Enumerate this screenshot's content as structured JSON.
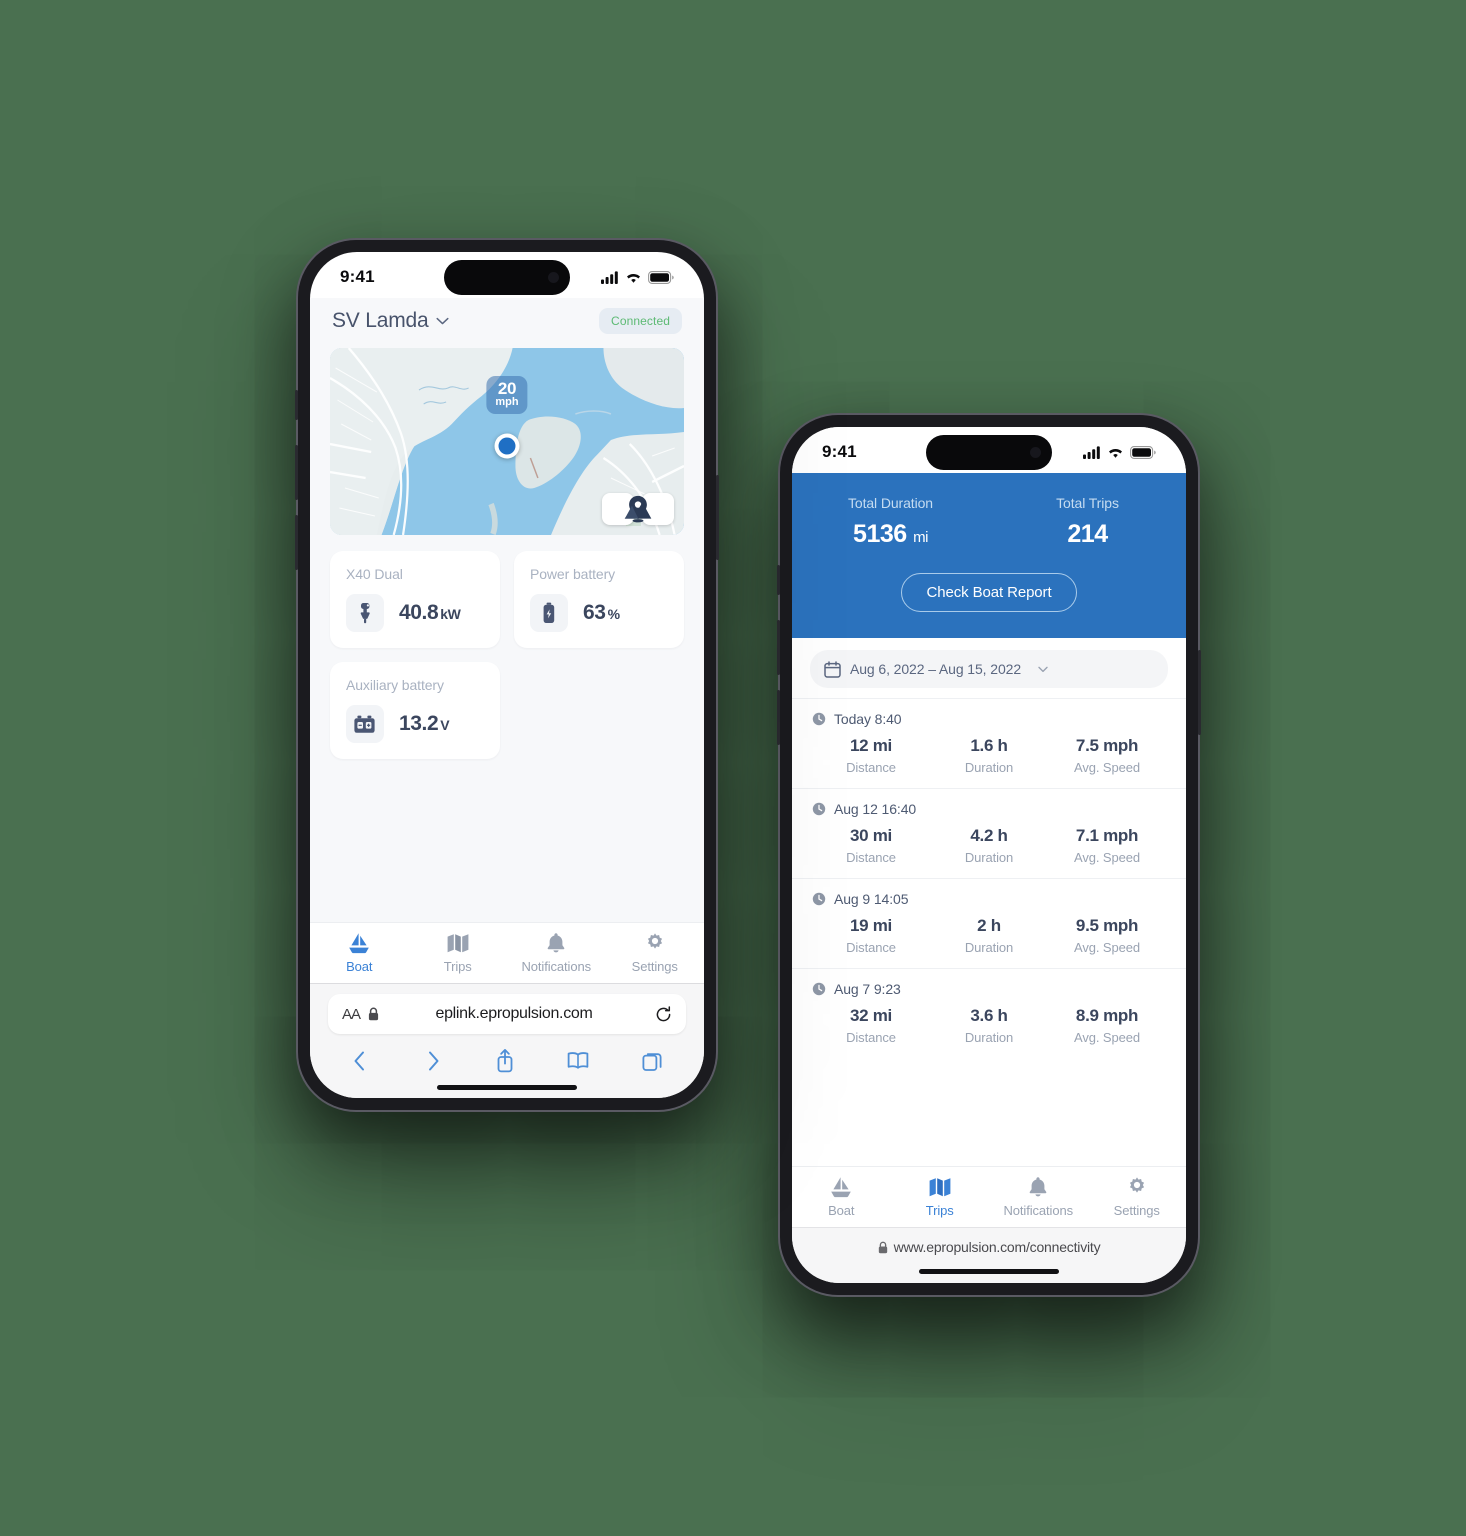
{
  "background_color": "#4a7050",
  "accent_blue": "#2b72bd",
  "phone_left": {
    "status_bar": {
      "time": "9:41",
      "signal_icon": "cellular-bars-icon",
      "wifi_icon": "wifi-icon",
      "battery_icon": "battery-icon"
    },
    "header": {
      "boat_name": "SV Lamda",
      "chevron_icon": "chevron-down-icon",
      "status_badge": "Connected",
      "status_color": "#5dba74"
    },
    "map": {
      "speed_value": "20",
      "speed_unit": "mph",
      "locate_icon": "location-pin-icon",
      "layers_icon": "mountain-layers-icon",
      "position_marker": "current-position-dot"
    },
    "cards": [
      {
        "label": "X40 Dual",
        "value": "40.8",
        "unit": "kW",
        "icon": "outboard-motor-icon"
      },
      {
        "label": "Power battery",
        "value": "63",
        "unit": "%",
        "icon": "battery-vertical-icon"
      },
      {
        "label": "Auxiliary battery",
        "value": "13.2",
        "unit": "V",
        "icon": "car-battery-icon"
      }
    ],
    "tabs": [
      {
        "label": "Boat",
        "icon": "sailboat-icon",
        "active": true
      },
      {
        "label": "Trips",
        "icon": "map-folded-icon",
        "active": false
      },
      {
        "label": "Notifications",
        "icon": "bell-icon",
        "active": false
      },
      {
        "label": "Settings",
        "icon": "gear-icon",
        "active": false
      }
    ],
    "browser": {
      "text_size_label": "AA",
      "lock_icon": "lock-icon",
      "url": "eplink.epropulsion.com",
      "reload_icon": "reload-icon",
      "back_icon": "chevron-left-icon",
      "forward_icon": "chevron-right-icon",
      "share_icon": "share-icon",
      "bookmarks_icon": "book-icon",
      "tabs_icon": "tabs-icon"
    }
  },
  "phone_right": {
    "status_bar": {
      "time": "9:41",
      "signal_icon": "cellular-bars-icon",
      "wifi_icon": "wifi-icon",
      "battery_icon": "battery-icon"
    },
    "hero": {
      "stats": [
        {
          "label": "Total Duration",
          "value": "5136",
          "unit": "mi"
        },
        {
          "label": "Total Trips",
          "value": "214",
          "unit": ""
        }
      ],
      "button_label": "Check Boat Report"
    },
    "date_range": {
      "calendar_icon": "calendar-icon",
      "text": "Aug 6, 2022  –  Aug 15, 2022",
      "chevron_icon": "chevron-down-small-icon"
    },
    "metric_labels": {
      "distance": "Distance",
      "duration": "Duration",
      "speed": "Avg. Speed"
    },
    "trips": [
      {
        "time": "Today 8:40",
        "clock_icon": "clock-icon",
        "distance": "12 mi",
        "duration": "1.6 h",
        "speed": "7.5 mph"
      },
      {
        "time": "Aug 12 16:40",
        "clock_icon": "clock-icon",
        "distance": "30 mi",
        "duration": "4.2 h",
        "speed": "7.1 mph"
      },
      {
        "time": "Aug 9 14:05",
        "clock_icon": "clock-icon",
        "distance": "19 mi",
        "duration": "2 h",
        "speed": "9.5 mph"
      },
      {
        "time": "Aug 7 9:23",
        "clock_icon": "clock-icon",
        "distance": "32 mi",
        "duration": "3.6 h",
        "speed": "8.9 mph"
      }
    ],
    "tabs": [
      {
        "label": "Boat",
        "icon": "sailboat-icon",
        "active": false
      },
      {
        "label": "Trips",
        "icon": "map-folded-icon",
        "active": true
      },
      {
        "label": "Notifications",
        "icon": "bell-icon",
        "active": false
      },
      {
        "label": "Settings",
        "icon": "gear-icon",
        "active": false
      }
    ],
    "browser": {
      "lock_icon": "lock-icon",
      "url": "www.epropulsion.com/connectivity"
    }
  }
}
